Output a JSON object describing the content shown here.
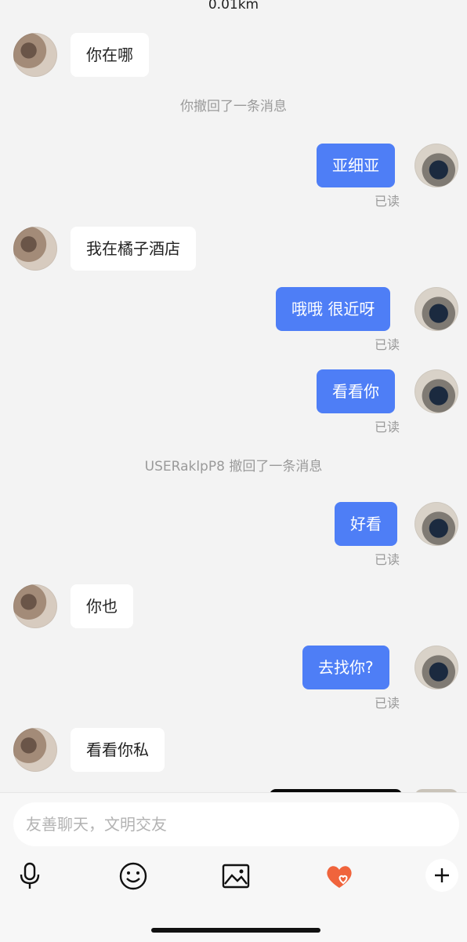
{
  "header": {
    "distance": "0.01km"
  },
  "messages": [
    {
      "text": "你在哪"
    },
    {
      "text": "你撤回了一条消息"
    },
    {
      "text": "亚细亚",
      "status": "已读"
    },
    {
      "text": "我在橘子酒店"
    },
    {
      "text": "哦哦 很近呀",
      "status": "已读"
    },
    {
      "text": "看看你",
      "status": "已读"
    },
    {
      "text": "USERaklpP8 撤回了一条消息"
    },
    {
      "text": "好看",
      "status": "已读"
    },
    {
      "text": "你也"
    },
    {
      "text": "去找你?",
      "status": "已读"
    },
    {
      "text": "看看你私"
    }
  ],
  "composer": {
    "placeholder": "友善聊天，文明交友",
    "tools": [
      "microphone-icon",
      "emoji-icon",
      "image-icon",
      "heart-icon",
      "plus-icon"
    ],
    "heart_color": "#f0643c",
    "send_color": "#4e7ef6"
  }
}
